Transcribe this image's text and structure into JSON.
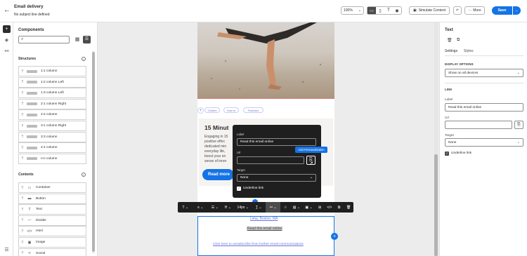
{
  "header": {
    "title": "Email delivery",
    "subtitle": "No subject line defined",
    "zoom": "100%",
    "simulate_label": "Simulate Content",
    "more_label": "More",
    "save_label": "Save"
  },
  "left": {
    "components_title": "Components",
    "search_placeholder": "",
    "structures_title": "Structures",
    "structures": [
      "1:1 column",
      "1:2 column Left",
      "1:3 column Left",
      "2:1 column Right",
      "2:2 column",
      "3:1 column Right",
      "3:3 column",
      "4:4 column",
      "n:n column"
    ],
    "contents_title": "Contents",
    "contents": [
      {
        "label": "Container",
        "icon": "container-icon",
        "glyph": "▭"
      },
      {
        "label": "Button",
        "icon": "button-icon",
        "glyph": "▬"
      },
      {
        "label": "Text",
        "icon": "text-icon",
        "glyph": "T"
      },
      {
        "label": "Divider",
        "icon": "divider-icon",
        "glyph": "—"
      },
      {
        "label": "Html",
        "icon": "html-icon",
        "glyph": "</>"
      },
      {
        "label": "Image",
        "icon": "image-icon",
        "glyph": "▣"
      },
      {
        "label": "Social",
        "icon": "social-icon",
        "glyph": "⋖"
      }
    ]
  },
  "email": {
    "nav_links": [
      "Guides",
      "How to",
      "Features"
    ],
    "article_title": "15 Minut",
    "article_body": [
      "Engaging in 15",
      "positive effec",
      "dedicated min",
      "everyday life,",
      "boost your en",
      "sense of inner"
    ],
    "read_more": "Read more",
    "address_partial": "Lima, Boston, MA",
    "read_online": "Read this email online",
    "unsubscribe": "Click here to unsubscribe from further email communications"
  },
  "popover": {
    "label_caption": "Label",
    "label_value": "Read this email online",
    "url_caption": "Url",
    "url_value": "",
    "tooltip": "Add Personalization",
    "target_caption": "Target",
    "target_value": "None",
    "underline_label": "Underline link"
  },
  "toolbar": {
    "font_size": "14px"
  },
  "right": {
    "title": "Text",
    "tab_settings": "Settings",
    "tab_styles": "Styles",
    "display_options_caption": "DISPLAY OPTIONS",
    "display_value": "Show on all devices",
    "link_caption": "LINK",
    "label_caption": "Label",
    "label_value": "Read this email online",
    "url_caption": "Url",
    "url_value": "",
    "target_caption": "Target",
    "target_value": "None",
    "underline_label": "Underline link"
  },
  "colors": {
    "accent": "#1473e6",
    "dark_panel": "#1f1f1f",
    "canvas_bg": "#ececec",
    "link_text": "#6b74d8"
  }
}
